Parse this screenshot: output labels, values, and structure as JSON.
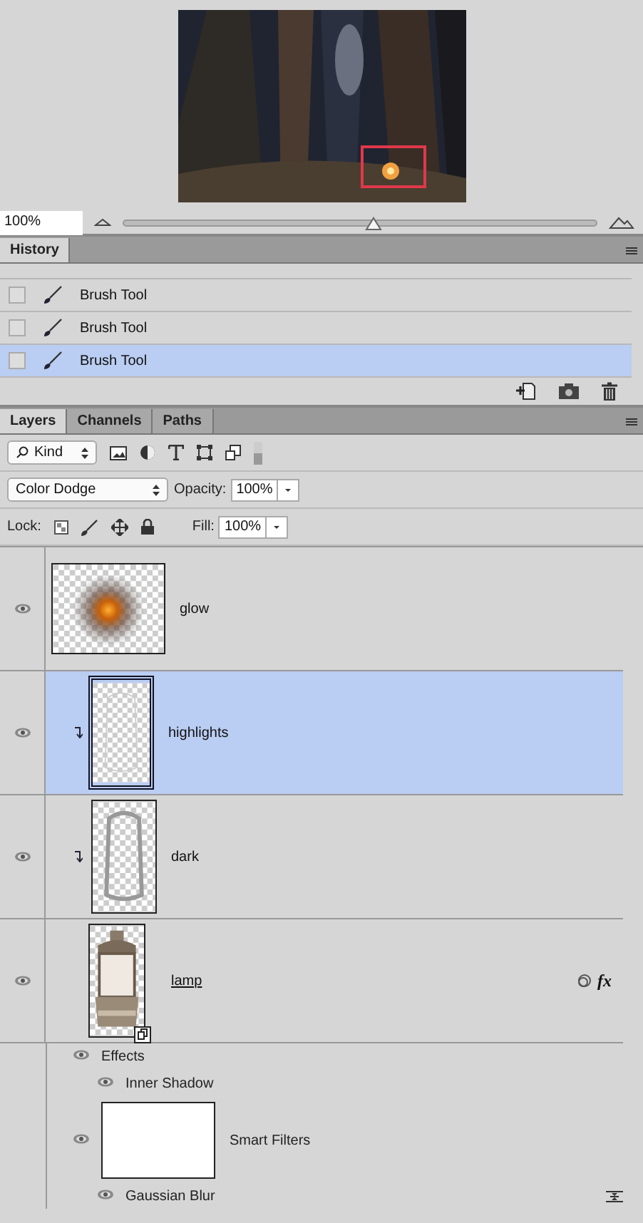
{
  "navigator": {
    "zoom": "100%",
    "zoom_slider": {
      "level": 0.53
    }
  },
  "history": {
    "title": "History",
    "rows": [
      {
        "label": "Brush Tool",
        "selected": false
      },
      {
        "label": "Brush Tool",
        "selected": false
      },
      {
        "label": "Brush Tool",
        "selected": true
      }
    ]
  },
  "layers_panel": {
    "tabs": [
      {
        "label": "Layers",
        "selected": true
      },
      {
        "label": "Channels",
        "selected": false
      },
      {
        "label": "Paths",
        "selected": false
      }
    ],
    "filter": "Kind",
    "blend_mode": "Color Dodge",
    "opacity_label": "Opacity:",
    "opacity": "100%",
    "lock_label": "Lock:",
    "fill_label": "Fill:",
    "fill": "100%",
    "layers": [
      {
        "name": "glow",
        "kind": "glow",
        "visible": true,
        "clipped": false,
        "selected": false
      },
      {
        "name": "highlights",
        "kind": "outline",
        "visible": true,
        "clipped": true,
        "selected": true
      },
      {
        "name": "dark",
        "kind": "outline",
        "visible": true,
        "clipped": true,
        "selected": false
      },
      {
        "name": "lamp",
        "kind": "lamp",
        "visible": true,
        "clipped": false,
        "selected": false,
        "fx": "fx",
        "children": [
          {
            "kind": "effects",
            "label": "Effects",
            "visible": true,
            "children": [
              {
                "label": "Inner Shadow",
                "visible": true
              }
            ]
          },
          {
            "kind": "smart_filters",
            "label": "Smart Filters",
            "visible": true,
            "children": [
              {
                "label": "Gaussian Blur",
                "visible": true
              }
            ]
          }
        ]
      }
    ]
  }
}
